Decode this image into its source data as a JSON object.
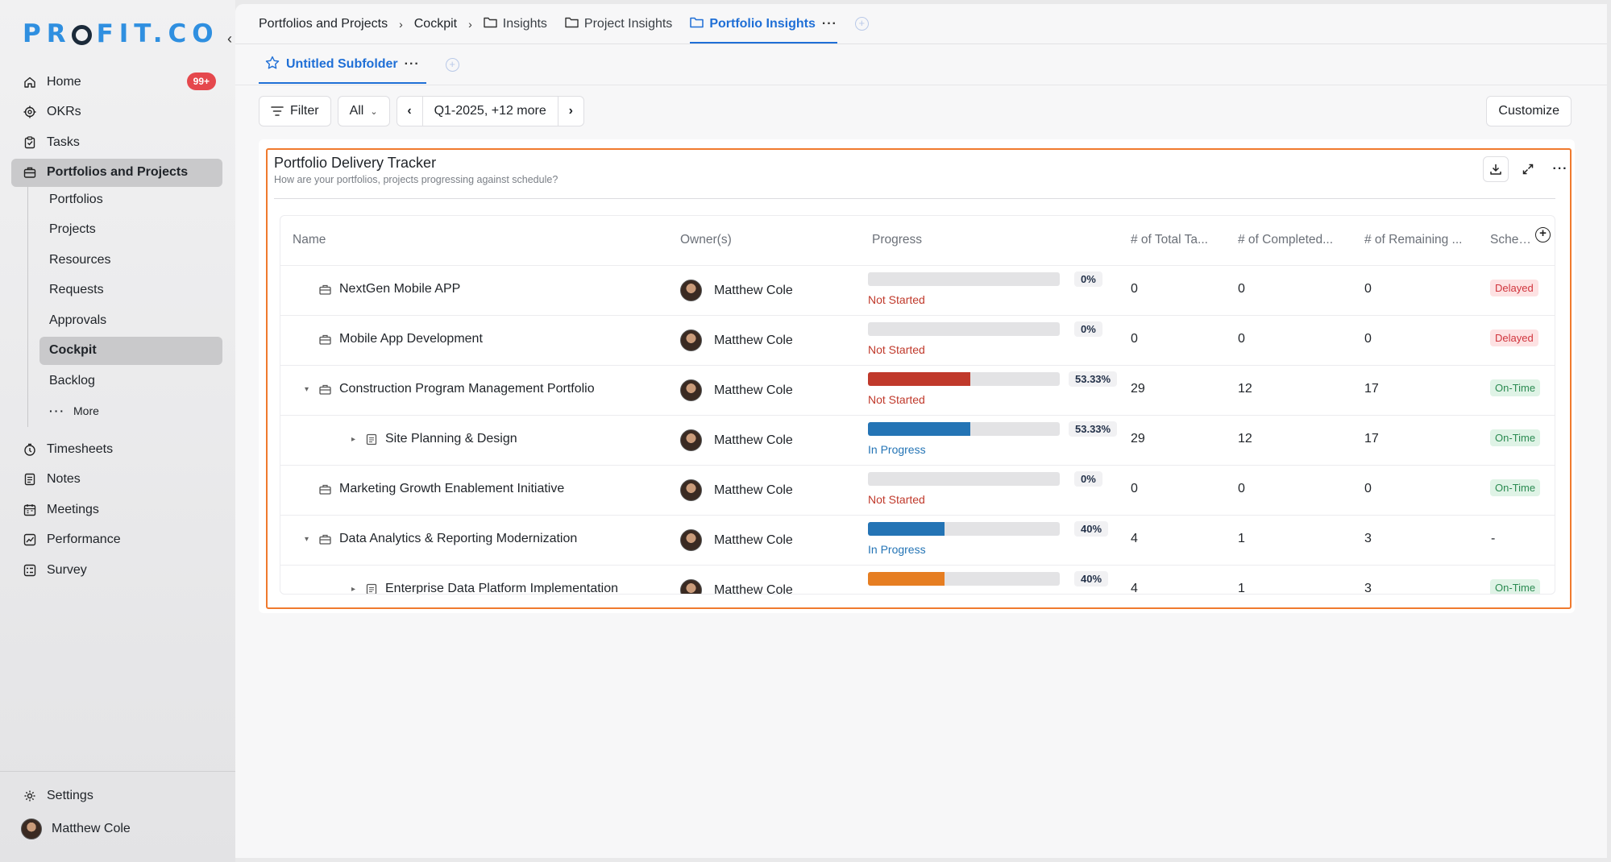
{
  "brand": {
    "logo_left": "PR",
    "logo_right": "FIT.CO"
  },
  "sidebar": {
    "collapse": "‹",
    "items": [
      {
        "label": "Home",
        "icon": "home-icon",
        "badge": "99+"
      },
      {
        "label": "OKRs",
        "icon": "target-icon"
      },
      {
        "label": "Tasks",
        "icon": "clipboard-icon"
      },
      {
        "label": "Portfolios and Projects",
        "icon": "briefcase-icon"
      }
    ],
    "subitems": [
      "Portfolios",
      "Projects",
      "Resources",
      "Requests",
      "Approvals",
      "Cockpit",
      "Backlog"
    ],
    "more_label": "More",
    "items2": [
      {
        "label": "Timesheets",
        "icon": "clock-icon"
      },
      {
        "label": "Notes",
        "icon": "notes-icon"
      },
      {
        "label": "Meetings",
        "icon": "calendar-icon"
      },
      {
        "label": "Performance",
        "icon": "chart-icon"
      },
      {
        "label": "Survey",
        "icon": "survey-icon"
      }
    ],
    "settings_label": "Settings",
    "user_name": "Matthew Cole"
  },
  "breadcrumb": {
    "crumbs": [
      "Portfolios and Projects",
      "Cockpit"
    ],
    "tabs": [
      "Insights",
      "Project Insights",
      "Portfolio Insights"
    ]
  },
  "subtabs": {
    "active": "Untitled Subfolder"
  },
  "toolbar": {
    "filter": "Filter",
    "all": "All",
    "period": "Q1-2025, +12 more",
    "customize": "Customize"
  },
  "widget": {
    "title": "Portfolio Delivery Tracker",
    "subtitle": "How are your portfolios, projects progressing against schedule?"
  },
  "table": {
    "headers": [
      "Name",
      "Owner(s)",
      "Progress",
      "# of Total Ta...",
      "# of Completed...",
      "# of Remaining ...",
      "Schedu"
    ],
    "rows": [
      {
        "name": "NextGen Mobile APP",
        "type": "portfolio",
        "level": 0,
        "caret": "",
        "owner": "Matthew Cole",
        "progress": 0,
        "pct": "0%",
        "bar_color": "#c0392b",
        "status": "Not Started",
        "status_color": "#c0392b",
        "total": "0",
        "completed": "0",
        "remaining": "0",
        "schedule": "Delayed",
        "schedule_type": "delayed"
      },
      {
        "name": "Mobile App Development",
        "type": "portfolio",
        "level": 0,
        "caret": "",
        "owner": "Matthew Cole",
        "progress": 0,
        "pct": "0%",
        "bar_color": "#c0392b",
        "status": "Not Started",
        "status_color": "#c0392b",
        "total": "0",
        "completed": "0",
        "remaining": "0",
        "schedule": "Delayed",
        "schedule_type": "delayed"
      },
      {
        "name": "Construction Program Management Portfolio",
        "type": "portfolio",
        "level": 0,
        "caret": "▾",
        "owner": "Matthew Cole",
        "progress": 53.33,
        "pct": "53.33%",
        "bar_color": "#c0392b",
        "status": "Not Started",
        "status_color": "#c0392b",
        "total": "29",
        "completed": "12",
        "remaining": "17",
        "schedule": "On-Time",
        "schedule_type": "ontime"
      },
      {
        "name": "Site Planning & Design",
        "type": "project",
        "level": 1,
        "caret": "▸",
        "owner": "Matthew Cole",
        "progress": 53.33,
        "pct": "53.33%",
        "bar_color": "#2474b5",
        "status": "In Progress",
        "status_color": "#2474b5",
        "total": "29",
        "completed": "12",
        "remaining": "17",
        "schedule": "On-Time",
        "schedule_type": "ontime"
      },
      {
        "name": "Marketing Growth Enablement Initiative",
        "type": "portfolio",
        "level": 0,
        "caret": "",
        "owner": "Matthew Cole",
        "progress": 0,
        "pct": "0%",
        "bar_color": "#c0392b",
        "status": "Not Started",
        "status_color": "#c0392b",
        "total": "0",
        "completed": "0",
        "remaining": "0",
        "schedule": "On-Time",
        "schedule_type": "ontime"
      },
      {
        "name": "Data Analytics & Reporting Modernization",
        "type": "portfolio",
        "level": 0,
        "caret": "▾",
        "owner": "Matthew Cole",
        "progress": 40,
        "pct": "40%",
        "bar_color": "#2474b5",
        "status": "In Progress",
        "status_color": "#2474b5",
        "total": "4",
        "completed": "1",
        "remaining": "3",
        "schedule": "-",
        "schedule_type": "none"
      },
      {
        "name": "Enterprise Data Platform Implementation",
        "type": "project",
        "level": 1,
        "caret": "▸",
        "owner": "Matthew Cole",
        "progress": 40,
        "pct": "40%",
        "bar_color": "#e67e22",
        "status": "",
        "status_color": "#2474b5",
        "total": "4",
        "completed": "1",
        "remaining": "3",
        "schedule": "On-Time",
        "schedule_type": "ontime"
      }
    ]
  }
}
